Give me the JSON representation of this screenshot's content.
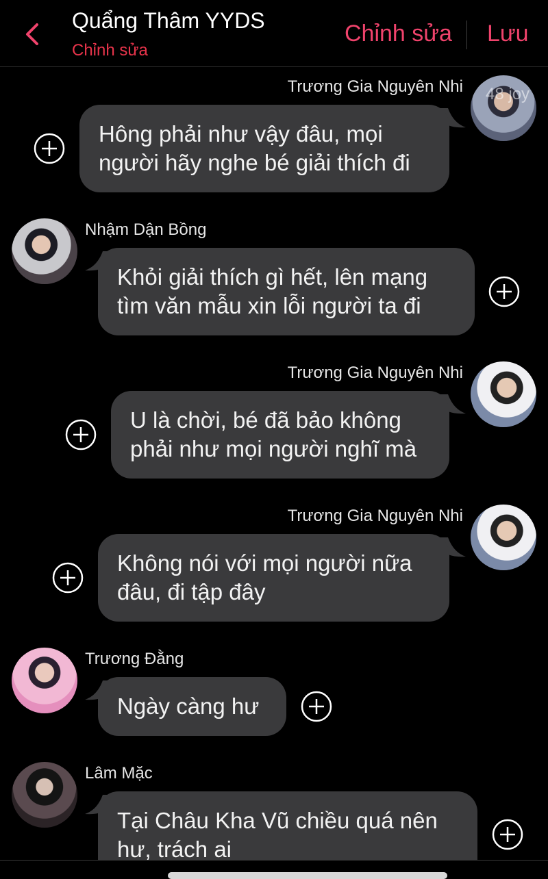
{
  "header": {
    "back_icon": "chevron-left-icon",
    "title": "Quẩng Thâm YYDS",
    "subtitle": "Chỉnh sửa",
    "edit_label": "Chỉnh sửa",
    "save_label": "Lưu",
    "accent_color": "#f0436c"
  },
  "watermark": "48 joy",
  "messages": [
    {
      "sender": "Trương Gia Nguyên Nhi",
      "side": "right",
      "line1": "Hông phải như vậy đâu, mọi",
      "line2": "người hãy nghe bé giải thích đi"
    },
    {
      "sender": "Nhậm Dận Bồng",
      "side": "left",
      "line1": "Khỏi giải thích gì hết, lên mạng",
      "line2": "tìm văn mẫu xin lỗi người ta đi"
    },
    {
      "sender": "Trương Gia Nguyên Nhi",
      "side": "right",
      "line1": "U là chời, bé đã bảo không",
      "line2": "phải như mọi người nghĩ mà"
    },
    {
      "sender": "Trương Gia Nguyên Nhi",
      "side": "right",
      "line1": "Không nói với mọi người nữa",
      "line2": "đâu, đi tập đây"
    },
    {
      "sender": "Trương Đằng",
      "side": "left",
      "line1": "Ngày càng hư"
    },
    {
      "sender": "Lâm Mặc",
      "side": "left",
      "line1": "Tại Châu Kha Vũ chiều quá nên",
      "line2": "hư, trách ai"
    }
  ],
  "icons": {
    "add": "plus-circle-icon"
  },
  "colors": {
    "bubble": "#3a3a3c",
    "background": "#000000"
  }
}
